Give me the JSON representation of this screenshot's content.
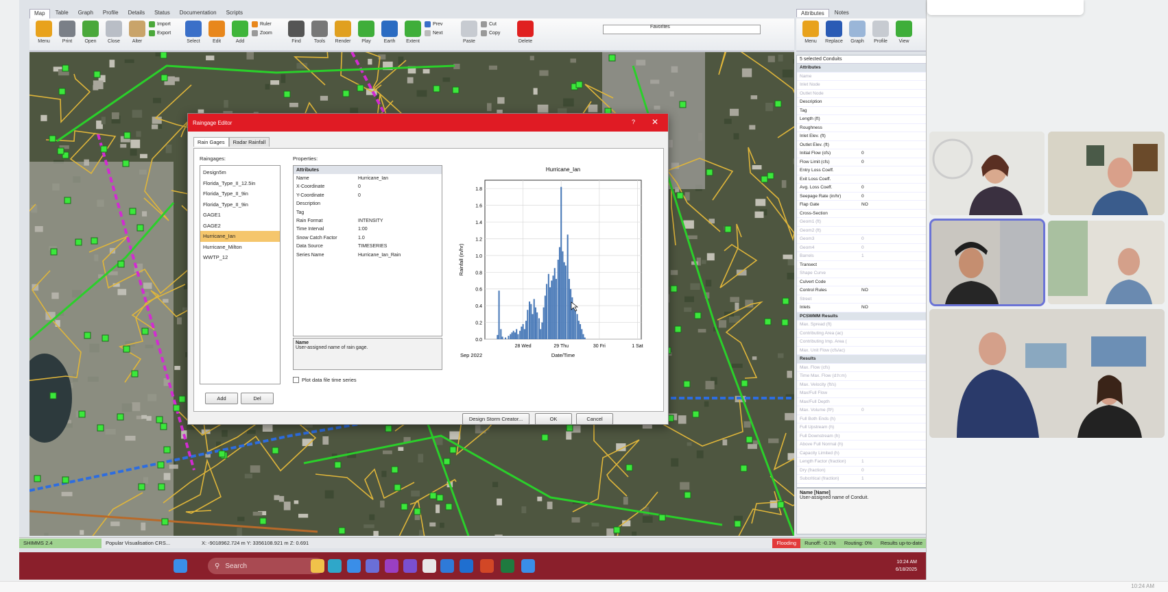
{
  "top_tabs": [
    "Map",
    "Table",
    "Graph",
    "Profile",
    "Details",
    "Status",
    "Documentation",
    "Scripts"
  ],
  "ribbon": {
    "buttons": [
      {
        "label": "Menu",
        "icon": "stack-icon",
        "color": "#e8a21c"
      },
      {
        "label": "Print",
        "icon": "printer-icon",
        "color": "#7a7f87"
      },
      {
        "label": "Open",
        "icon": "open-icon",
        "color": "#4aa83a"
      },
      {
        "label": "Close",
        "icon": "close-layers-icon",
        "color": "#b9bec6"
      },
      {
        "label": "Alter",
        "icon": "alter-icon",
        "color": "#c9a46a"
      }
    ],
    "small_a": [
      {
        "label": "Import",
        "color": "#4aa83a"
      },
      {
        "label": "Export",
        "color": "#4aa83a"
      }
    ],
    "buttons2": [
      {
        "label": "Select",
        "icon": "cursor-icon",
        "color": "#3a6fc8"
      },
      {
        "label": "Edit",
        "icon": "edit-icon",
        "color": "#e8871c"
      },
      {
        "label": "Add",
        "icon": "add-icon",
        "color": "#3fb53a"
      }
    ],
    "small_b": [
      {
        "label": "Ruler",
        "color": "#e8871c"
      },
      {
        "label": "Zoom",
        "color": "#999"
      }
    ],
    "buttons3": [
      {
        "label": "Find",
        "icon": "binoculars-icon",
        "color": "#555"
      },
      {
        "label": "Tools",
        "icon": "tools-icon",
        "color": "#777"
      },
      {
        "label": "Render",
        "icon": "render-icon",
        "color": "#e0a020"
      },
      {
        "label": "Play",
        "icon": "globe-green-icon",
        "color": "#3fae3a"
      },
      {
        "label": "Earth",
        "icon": "earth-icon",
        "color": "#2a6bc2"
      },
      {
        "label": "Extent",
        "icon": "extent-icon",
        "color": "#3fae3a"
      }
    ],
    "small_c": [
      {
        "label": "Prev",
        "color": "#3a6fc8"
      },
      {
        "label": "Next",
        "color": "#bbb"
      }
    ],
    "buttons4": [
      {
        "label": "Paste",
        "icon": "paste-icon",
        "color": "#c7cbd1"
      }
    ],
    "small_d": [
      {
        "label": "Cut",
        "color": "#999"
      },
      {
        "label": "Copy",
        "color": "#999"
      }
    ],
    "buttons5": [
      {
        "label": "Delete",
        "icon": "delete-icon",
        "color": "#e02020"
      }
    ],
    "favorites_label": "Favorites"
  },
  "side": {
    "tabs": [
      "Attributes",
      "Notes"
    ],
    "buttons": [
      {
        "label": "Menu",
        "icon": "stack-icon",
        "color": "#e8a21c"
      },
      {
        "label": "Replace",
        "icon": "fx-icon",
        "color": "#2a5bb5"
      },
      {
        "label": "Graph",
        "icon": "graph-icon",
        "color": "#9ab6d8"
      },
      {
        "label": "Profile",
        "icon": "profile-icon",
        "color": "#c7cbd1"
      },
      {
        "label": "View",
        "icon": "view-icon",
        "color": "#3fae3a"
      }
    ],
    "selection_title": "5 selected Conduits",
    "rows": [
      {
        "k": "Attributes",
        "v": "",
        "hdr": true
      },
      {
        "k": "Name",
        "v": "",
        "dim": true
      },
      {
        "k": "Inlet Node",
        "v": "",
        "dim": true
      },
      {
        "k": "Outlet Node",
        "v": "",
        "dim": true
      },
      {
        "k": "Description",
        "v": ""
      },
      {
        "k": "Tag",
        "v": ""
      },
      {
        "k": "Length (ft)",
        "v": ""
      },
      {
        "k": "Roughness",
        "v": ""
      },
      {
        "k": "Inlet Elev. (ft)",
        "v": ""
      },
      {
        "k": "Outlet Elev. (ft)",
        "v": ""
      },
      {
        "k": "Initial Flow (cfs)",
        "v": "0"
      },
      {
        "k": "Flow Limit (cfs)",
        "v": "0"
      },
      {
        "k": "Entry Loss Coeff.",
        "v": ""
      },
      {
        "k": "Exit Loss Coeff.",
        "v": ""
      },
      {
        "k": "Avg. Loss Coeff.",
        "v": "0"
      },
      {
        "k": "Seepage Rate (in/hr)",
        "v": "0"
      },
      {
        "k": "Flap Gate",
        "v": "NO"
      },
      {
        "k": "Cross-Section",
        "v": ""
      },
      {
        "k": "Geom1 (ft)",
        "v": "",
        "dim": true
      },
      {
        "k": "Geom2 (ft)",
        "v": "",
        "dim": true
      },
      {
        "k": "Geom3",
        "v": "0",
        "dim": true
      },
      {
        "k": "Geom4",
        "v": "0",
        "dim": true
      },
      {
        "k": "Barrels",
        "v": "1",
        "dim": true
      },
      {
        "k": "Transect",
        "v": ""
      },
      {
        "k": "Shape Curve",
        "v": "",
        "dim": true
      },
      {
        "k": "Culvert Code",
        "v": ""
      },
      {
        "k": "Control Rules",
        "v": "NO"
      },
      {
        "k": "Street",
        "v": "",
        "dim": true
      },
      {
        "k": "Inlets",
        "v": "NO"
      },
      {
        "k": "PCSWMM Results",
        "v": "",
        "hdr": true
      },
      {
        "k": "Max. Spread (ft)",
        "v": "",
        "dim": true
      },
      {
        "k": "Contributing Area (ac)",
        "v": "",
        "dim": true
      },
      {
        "k": "Contributing Imp. Area (",
        "v": "",
        "dim": true
      },
      {
        "k": "Max. Unit Flow (cfs/ac)",
        "v": "",
        "dim": true
      },
      {
        "k": "Results",
        "v": "",
        "hdr": true
      },
      {
        "k": "Max. Flow (cfs)",
        "v": "",
        "dim": true
      },
      {
        "k": "Time Max. Flow (d:h:m)",
        "v": "",
        "dim": true
      },
      {
        "k": "Max. Velocity (ft/s)",
        "v": "",
        "dim": true
      },
      {
        "k": "Max/Full Flow",
        "v": "",
        "dim": true
      },
      {
        "k": "Max/Full Depth",
        "v": "",
        "dim": true
      },
      {
        "k": "Max. Volume (ft³)",
        "v": "0",
        "dim": true
      },
      {
        "k": "Full Both Ends (h)",
        "v": "",
        "dim": true
      },
      {
        "k": "Full Upstream (h)",
        "v": "",
        "dim": true
      },
      {
        "k": "Full Downstream (h)",
        "v": "",
        "dim": true
      },
      {
        "k": "Above Full Normal (h)",
        "v": "",
        "dim": true
      },
      {
        "k": "Capacity Limited (h)",
        "v": "",
        "dim": true
      },
      {
        "k": "Length Factor (fraction)",
        "v": "1",
        "dim": true
      },
      {
        "k": "Dry (fraction)",
        "v": "0",
        "dim": true
      },
      {
        "k": "Subcritical (fraction)",
        "v": "1",
        "dim": true
      }
    ],
    "desc_title": "Name [Name]",
    "desc_text": "User-assigned name of Conduit."
  },
  "statusbar": {
    "layer": "SHIMMS 2.4",
    "basemap": "Popular Visualisation CRS...",
    "coords": "X: -9018962.724 m  Y: 3356108.921 m  Z: 0.691",
    "flooding": "Flooding",
    "runoff": "Runoff: -0.1%",
    "routing": "Routing: 0%",
    "results": "Results up-to-date"
  },
  "taskbar": {
    "search_placeholder": "Search",
    "time": "10:24 AM",
    "date": "6/18/2025",
    "icons": [
      {
        "name": "start-icon",
        "color": "#3a8ee8"
      },
      {
        "name": "explorer-icon",
        "color": "#f0c24a"
      },
      {
        "name": "edge-icon",
        "color": "#2fa7c9"
      },
      {
        "name": "network-icon",
        "color": "#3a8ee8"
      },
      {
        "name": "teams-icon",
        "color": "#6a6fd8"
      },
      {
        "name": "onenote-icon",
        "color": "#9a3fc2"
      },
      {
        "name": "vs-icon",
        "color": "#7a4fd0"
      },
      {
        "name": "chrome-icon",
        "color": "#e8e8e8"
      },
      {
        "name": "app-icon",
        "color": "#2f7ad8"
      },
      {
        "name": "outlook-icon",
        "color": "#1f6fd0"
      },
      {
        "name": "powerpoint-icon",
        "color": "#d24726"
      },
      {
        "name": "excel-icon",
        "color": "#1f7a3f"
      },
      {
        "name": "pcswmm-icon",
        "color": "#3a8ee8"
      }
    ]
  },
  "dialog": {
    "title": "Raingage Editor",
    "help": "?",
    "close": "✕",
    "tabs": [
      "Rain Gages",
      "Radar Rainfall"
    ],
    "raingages_label": "Raingages:",
    "gages": [
      "Design5m",
      "Florida_Type_II_12.5in",
      "Florida_Type_II_9in",
      "Florida_Type_II_9in",
      "GAGE1",
      "GAGE2",
      "Hurricane_Ian",
      "Hurricane_Milton",
      "WWTP_12"
    ],
    "selected_gage": "Hurricane_Ian",
    "add": "Add",
    "del": "Del",
    "properties_label": "Properties:",
    "props": [
      {
        "k": "Attributes",
        "v": "",
        "hdr": true
      },
      {
        "k": "Name",
        "v": "Hurricane_Ian"
      },
      {
        "k": "X-Coordinate",
        "v": "0"
      },
      {
        "k": "Y-Coordinate",
        "v": "0"
      },
      {
        "k": "Description",
        "v": ""
      },
      {
        "k": "Tag",
        "v": ""
      },
      {
        "k": "Rain Format",
        "v": "INTENSITY"
      },
      {
        "k": "Time Interval",
        "v": "1:00"
      },
      {
        "k": "Snow Catch Factor",
        "v": "1.0"
      },
      {
        "k": "Data Source",
        "v": "TIMESERIES"
      },
      {
        "k": "Series Name",
        "v": "Hurricane_Ian_Rain"
      }
    ],
    "desc_title": "Name",
    "desc_text": "User-assigned name of rain gage.",
    "plot_checkbox": "Plot data file time series",
    "design_storm": "Design Storm Creator...",
    "ok": "OK",
    "cancel": "Cancel"
  },
  "chart_data": {
    "type": "bar",
    "title": "Hurricane_Ian",
    "xlabel": "Date/Time",
    "ylabel": "Rainfall (in/hr)",
    "x_start_label": "Sep 2022",
    "x_ticks": [
      {
        "pos": 1.0,
        "label": "28 Wed"
      },
      {
        "pos": 2.0,
        "label": "29 Thu"
      },
      {
        "pos": 3.0,
        "label": "30 Fri"
      },
      {
        "pos": 4.0,
        "label": "1 Sat"
      }
    ],
    "xlim": [
      0.0,
      4.1
    ],
    "ylim": [
      0,
      1.9
    ],
    "yticks": [
      0.0,
      0.2,
      0.4,
      0.6,
      0.8,
      1.0,
      1.2,
      1.4,
      1.6,
      1.8
    ],
    "bar_color": "#4a7ab8",
    "grid": true,
    "x": [
      0.33,
      0.37,
      0.42,
      0.46,
      0.5,
      0.54,
      0.58,
      0.62,
      0.67,
      0.71,
      0.75,
      0.79,
      0.83,
      0.87,
      0.92,
      0.96,
      1.0,
      1.04,
      1.08,
      1.12,
      1.17,
      1.21,
      1.25,
      1.29,
      1.33,
      1.37,
      1.42,
      1.46,
      1.5,
      1.54,
      1.58,
      1.62,
      1.67,
      1.71,
      1.75,
      1.79,
      1.83,
      1.87,
      1.92,
      1.96,
      2.0,
      2.04,
      2.08,
      2.12,
      2.17,
      2.21,
      2.25,
      2.29,
      2.33,
      2.37,
      2.42,
      2.46,
      2.5,
      2.54,
      2.58,
      2.62
    ],
    "values": [
      0.05,
      0.58,
      0.12,
      0.03,
      0.0,
      0.02,
      0.0,
      0.04,
      0.06,
      0.08,
      0.1,
      0.08,
      0.12,
      0.06,
      0.1,
      0.15,
      0.18,
      0.12,
      0.22,
      0.35,
      0.45,
      0.42,
      0.3,
      0.48,
      0.38,
      0.32,
      0.25,
      0.12,
      0.2,
      0.38,
      0.52,
      0.66,
      0.78,
      0.62,
      0.7,
      0.76,
      0.85,
      0.72,
      0.95,
      1.1,
      1.82,
      1.05,
      0.92,
      0.88,
      1.25,
      0.72,
      0.6,
      0.5,
      0.42,
      0.36,
      0.3,
      0.22,
      0.18,
      0.12,
      0.06,
      0.02
    ]
  }
}
